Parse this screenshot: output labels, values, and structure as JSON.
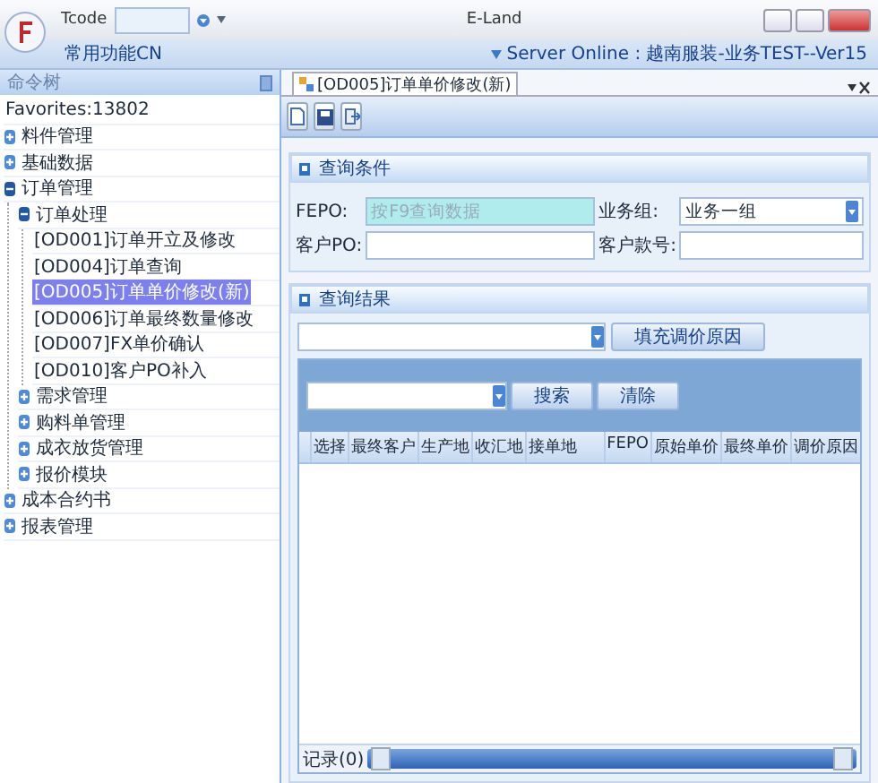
{
  "window": {
    "title": "E-Land",
    "tcode_label": "Tcode"
  },
  "ribbon": {
    "menu_label": "常用功能CN",
    "status": "Server Online : 越南服装-业务TEST--Ver15"
  },
  "sidebar": {
    "title": "命令树",
    "tree": [
      {
        "label": "Favorites:13802",
        "selected": false
      },
      {
        "label": "料件管理",
        "expanded": false,
        "selected": false
      },
      {
        "label": "基础数据",
        "expanded": false,
        "selected": false
      },
      {
        "label": "订单管理",
        "expanded": true,
        "selected": false,
        "children": [
          {
            "label": "订单处理",
            "expanded": true,
            "selected": false,
            "children": [
              {
                "label": "[OD001]订单开立及修改",
                "selected": false
              },
              {
                "label": "[OD004]订单查询",
                "selected": false
              },
              {
                "label": "[OD005]订单单价修改(新)",
                "selected": true
              },
              {
                "label": "[OD006]订单最终数量修改",
                "selected": false
              },
              {
                "label": "[OD007]FX单价确认",
                "selected": false
              },
              {
                "label": "[OD010]客户PO补入",
                "selected": false
              }
            ]
          },
          {
            "label": "需求管理",
            "expanded": false,
            "selected": false
          },
          {
            "label": "购料单管理",
            "expanded": false,
            "selected": false
          },
          {
            "label": "成衣放货管理",
            "expanded": false,
            "selected": false
          },
          {
            "label": "报价模块",
            "expanded": false,
            "selected": false
          }
        ]
      },
      {
        "label": "成本合约书",
        "expanded": false,
        "selected": false
      },
      {
        "label": "报表管理",
        "expanded": false,
        "selected": false
      }
    ]
  },
  "tabs": [
    {
      "label": "[OD005]订单单价修改(新)",
      "selected": true
    }
  ],
  "query": {
    "title": "查询条件",
    "fields": [
      {
        "label": "FEPO:",
        "placeholder": "按F9查询数据",
        "kind": "highlight"
      },
      {
        "label": "业务组:",
        "value": "业务一组",
        "kind": "dropdown"
      },
      {
        "label": "客户PO:",
        "kind": "text"
      },
      {
        "label": "客户款号:",
        "kind": "text"
      }
    ]
  },
  "results": {
    "title": "查询结果",
    "fill_button": "填充调价原因",
    "search_button": "搜索",
    "clear_button": "清除",
    "columns": [
      "选择",
      "最终客户",
      "生产地",
      "收汇地",
      "接单地",
      "FEPO",
      "原始单价",
      "最终单价",
      "调价原因"
    ],
    "record_count": "记录(0)"
  }
}
